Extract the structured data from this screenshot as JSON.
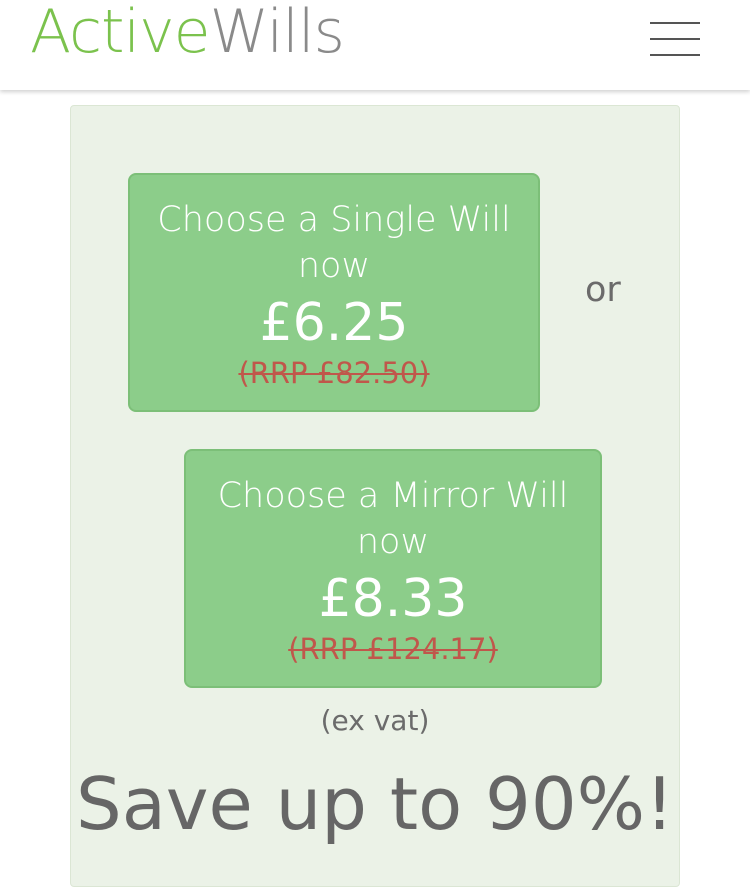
{
  "header": {
    "logo_active": "Active",
    "logo_wills": "Wills",
    "menu_icon": "hamburger-menu-icon"
  },
  "offers": {
    "single": {
      "label": "Choose a Single Will now",
      "price": "£6.25",
      "rrp": "(RRP £82.50)"
    },
    "separator": "or",
    "mirror": {
      "label": "Choose a Mirror Will now",
      "price": "£8.33",
      "rrp": "(RRP £124.17)"
    },
    "vat_note": "(ex vat)",
    "savings": "Save up to 90%!"
  },
  "colors": {
    "brand_green": "#7bc24d",
    "brand_grey": "#8a8a8a",
    "button_green": "#8ccd8a",
    "panel_bg": "#ebf2e7",
    "strike_red": "#c0574b"
  }
}
